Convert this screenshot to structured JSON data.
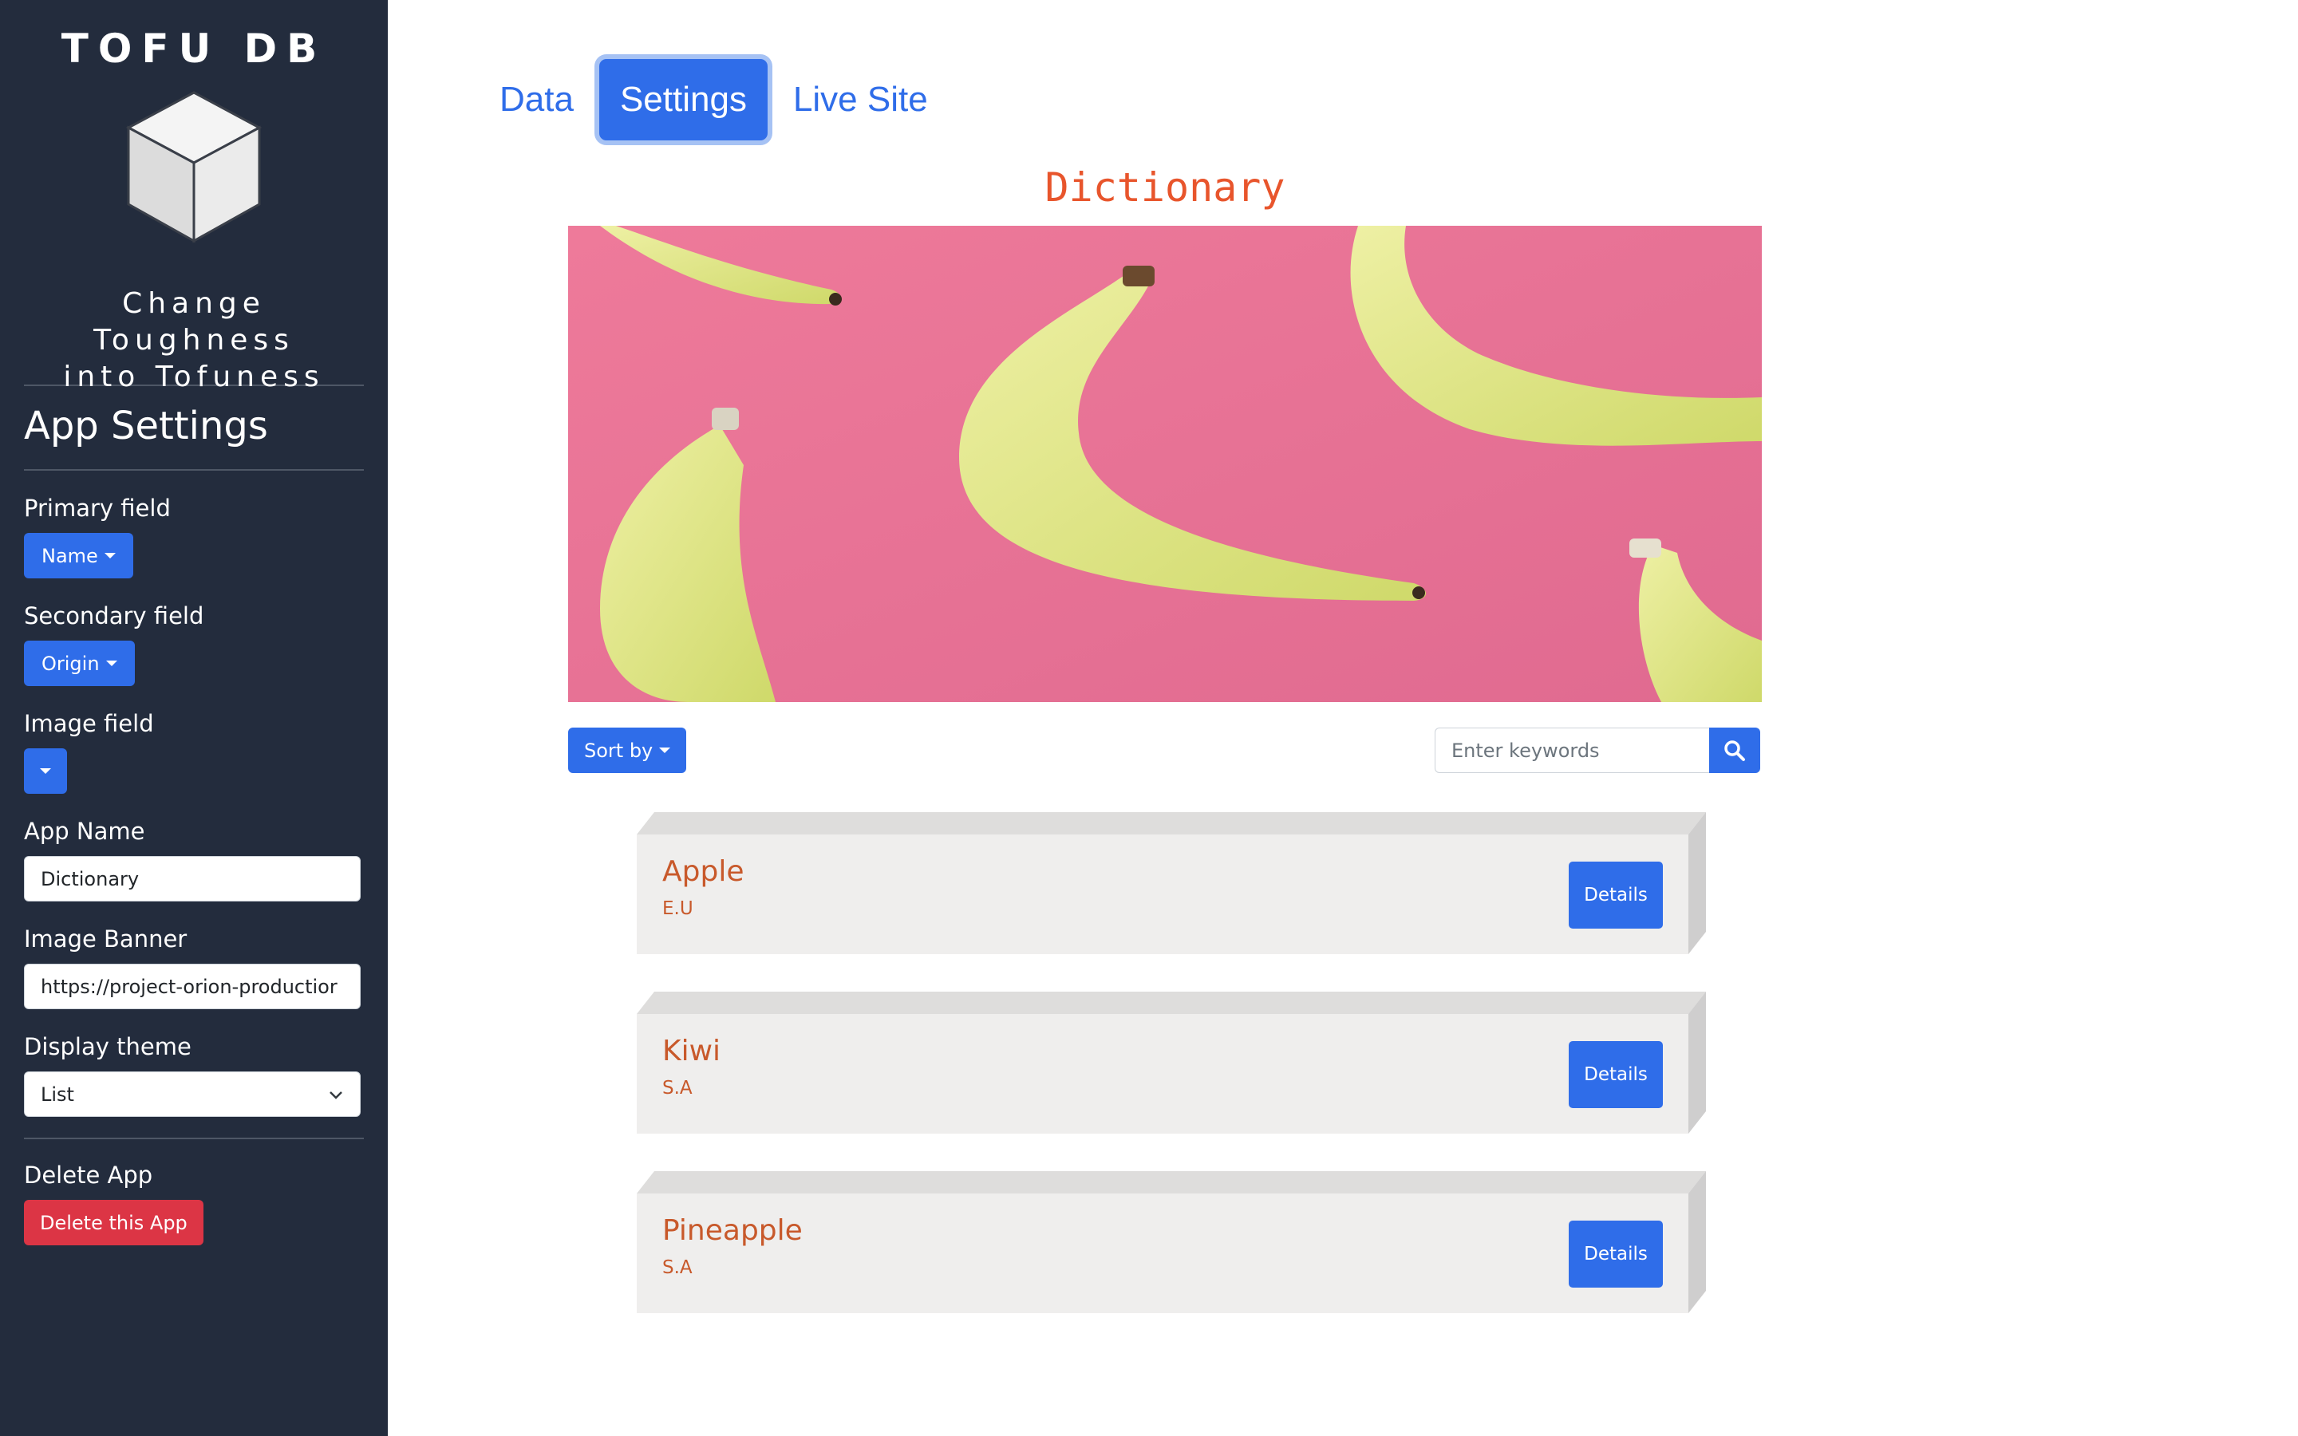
{
  "sidebar": {
    "brand": "TOFU DB",
    "tagline_line1": "Change Toughness",
    "tagline_line2": "into Tofuness",
    "settings_title": "App Settings",
    "primary_field": {
      "label": "Primary field",
      "value": "Name"
    },
    "secondary_field": {
      "label": "Secondary field",
      "value": "Origin"
    },
    "image_field": {
      "label": "Image field",
      "value": ""
    },
    "app_name": {
      "label": "App Name",
      "value": "Dictionary"
    },
    "image_banner": {
      "label": "Image Banner",
      "value": "https://project-orion-productior"
    },
    "display_theme": {
      "label": "Display theme",
      "value": "List"
    },
    "delete": {
      "label": "Delete App",
      "button": "Delete this App"
    }
  },
  "tabs": [
    {
      "label": "Data",
      "active": false
    },
    {
      "label": "Settings",
      "active": true
    },
    {
      "label": "Live Site",
      "active": false
    }
  ],
  "main": {
    "title": "Dictionary",
    "sort_label": "Sort by",
    "search_placeholder": "Enter keywords",
    "cards": [
      {
        "name": "Apple",
        "origin": "E.U",
        "button": "Details"
      },
      {
        "name": "Kiwi",
        "origin": "S.A",
        "button": "Details"
      },
      {
        "name": "Pineapple",
        "origin": "S.A",
        "button": "Details"
      }
    ]
  },
  "colors": {
    "sidebar_bg": "#232c3d",
    "accent_blue": "#2f6de9",
    "danger_red": "#dc3545",
    "title_orange": "#e8552c",
    "card_text": "#c8592b",
    "banner_pink": "#e97598"
  }
}
